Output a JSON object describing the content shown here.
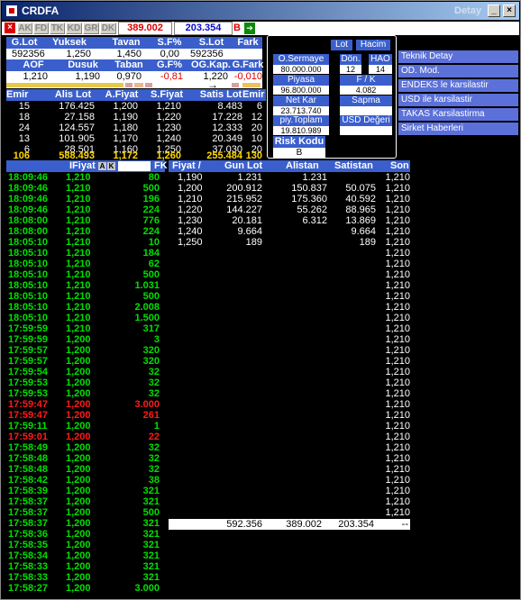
{
  "window": {
    "title": "CRDFA",
    "subtitle": "Detay"
  },
  "toolbar": {
    "buttons": [
      "AK",
      "FD",
      "TK",
      "KD",
      "GR",
      "DK"
    ],
    "sell_total": "389.002",
    "buy_total": "203.354",
    "b_label": "B"
  },
  "summary": {
    "headers1": [
      "G.Lot",
      "Yuksek",
      "Tavan",
      "S.F%",
      "S.Lot",
      "Fark"
    ],
    "values1": [
      "592356",
      "1,250",
      "1,450",
      "0,00",
      "592356",
      ""
    ],
    "headers2": [
      "AOF",
      "Dusuk",
      "Taban",
      "G.F%",
      "OG.Kap.",
      "G.Fark"
    ],
    "values2": [
      "1,210",
      "1,190",
      "0,970",
      "-0,81",
      "1,220",
      "-0,010"
    ]
  },
  "emir": {
    "headers": [
      "Emir",
      "Alis Lot",
      "A.Fiyat",
      "S.Fiyat",
      "Satis Lot",
      "Emir"
    ],
    "rows": [
      [
        "15",
        "176.425",
        "1,200",
        "1,210",
        "8.483",
        "6"
      ],
      [
        "18",
        "27.158",
        "1,190",
        "1,220",
        "17.228",
        "12"
      ],
      [
        "24",
        "124.557",
        "1,180",
        "1,230",
        "12.333",
        "20"
      ],
      [
        "13",
        "101.905",
        "1,170",
        "1,240",
        "20.349",
        "10"
      ],
      [
        "6",
        "28.501",
        "1,160",
        "1,250",
        "37.030",
        "20"
      ]
    ],
    "total": [
      "106",
      "588.493",
      "1,172",
      "1,260",
      "255.484",
      "130"
    ]
  },
  "panel": {
    "lot": "Lot",
    "hacim": "Hacim",
    "o_sermaye_label": "O.Sermaye",
    "o_sermaye_value": "80.000.000",
    "don_label": "Dön.",
    "don_value": "12",
    "hao_label": "HAO",
    "hao_value": "14",
    "piyasa_label": "Piyasa Değeri",
    "piyasa_value": "96.800.000",
    "fk_label": "F / K",
    "fk_value": "4.082",
    "netkar_label": "Net Kar",
    "netkar_value": "23.713.740",
    "sapma_label": "Sapma",
    "sapma_value": "",
    "piy_label": "piy.Toplam Lot",
    "piy_value": "19.810.989",
    "usd_label": "USD Değeri",
    "usd_value": "",
    "risk_label": "Risk Kodu",
    "risk_value": "B"
  },
  "links": [
    "Teknik Detay",
    "OD. Mod.",
    "ENDEKS le karsilastir",
    "USD ile karsilastir",
    "TAKAS Karsilastirma",
    "Sirket Haberleri"
  ],
  "trades_header": {
    "fiyat": "IFiyat",
    "a": "A",
    "k": "K",
    "fk": "FK"
  },
  "trades": [
    [
      "18:09:46",
      "1,210",
      "80",
      "up"
    ],
    [
      "18:09:46",
      "1,210",
      "500",
      "up"
    ],
    [
      "18:09:46",
      "1,210",
      "196",
      "up"
    ],
    [
      "18:09:46",
      "1,210",
      "224",
      "up"
    ],
    [
      "18:08:00",
      "1,210",
      "776",
      "up"
    ],
    [
      "18:08:00",
      "1,210",
      "224",
      "up"
    ],
    [
      "18:05:10",
      "1,210",
      "10",
      "up"
    ],
    [
      "18:05:10",
      "1,210",
      "184",
      "up"
    ],
    [
      "18:05:10",
      "1,210",
      "62",
      "up"
    ],
    [
      "18:05:10",
      "1,210",
      "500",
      "up"
    ],
    [
      "18:05:10",
      "1,210",
      "1.031",
      "up"
    ],
    [
      "18:05:10",
      "1,210",
      "500",
      "up"
    ],
    [
      "18:05:10",
      "1,210",
      "2.008",
      "up"
    ],
    [
      "18:05:10",
      "1,210",
      "1.500",
      "up"
    ],
    [
      "17:59:59",
      "1,210",
      "317",
      "up"
    ],
    [
      "17:59:59",
      "1,200",
      "3",
      "up"
    ],
    [
      "17:59:57",
      "1,200",
      "320",
      "up"
    ],
    [
      "17:59:57",
      "1,200",
      "320",
      "up"
    ],
    [
      "17:59:54",
      "1,200",
      "32",
      "up"
    ],
    [
      "17:59:53",
      "1,200",
      "32",
      "up"
    ],
    [
      "17:59:53",
      "1,200",
      "32",
      "up"
    ],
    [
      "17:59:47",
      "1,200",
      "3.000",
      "down"
    ],
    [
      "17:59:47",
      "1,200",
      "261",
      "down"
    ],
    [
      "17:59:11",
      "1,200",
      "1",
      "up"
    ],
    [
      "17:59:01",
      "1,200",
      "22",
      "down"
    ],
    [
      "17:58:49",
      "1,200",
      "32",
      "up"
    ],
    [
      "17:58:48",
      "1,200",
      "32",
      "up"
    ],
    [
      "17:58:48",
      "1,200",
      "32",
      "up"
    ],
    [
      "17:58:42",
      "1,200",
      "38",
      "up"
    ],
    [
      "17:58:39",
      "1,200",
      "321",
      "up"
    ],
    [
      "17:58:37",
      "1,200",
      "321",
      "up"
    ],
    [
      "17:58:37",
      "1,200",
      "500",
      "up"
    ],
    [
      "17:58:37",
      "1,200",
      "321",
      "up"
    ],
    [
      "17:58:36",
      "1,200",
      "321",
      "up"
    ],
    [
      "17:58:35",
      "1,200",
      "321",
      "up"
    ],
    [
      "17:58:34",
      "1,200",
      "321",
      "up"
    ],
    [
      "17:58:33",
      "1,200",
      "321",
      "up"
    ],
    [
      "17:58:33",
      "1,200",
      "321",
      "up"
    ],
    [
      "17:58:27",
      "1,200",
      "3.000",
      "up"
    ]
  ],
  "depth_header": [
    "Fiyat /",
    "Gun Lot",
    "Alistan",
    "Satistan",
    "Son"
  ],
  "depth": [
    [
      "1,190",
      "1.231",
      "1.231",
      ""
    ],
    [
      "1,200",
      "200.912",
      "150.837",
      "50.075"
    ],
    [
      "1,210",
      "215.952",
      "175.360",
      "40.592"
    ],
    [
      "1,220",
      "144.227",
      "55.262",
      "88.965"
    ],
    [
      "1,230",
      "20.181",
      "6.312",
      "13.869"
    ],
    [
      "1,240",
      "9.664",
      "",
      "9.664"
    ],
    [
      "1,250",
      "189",
      "",
      "189"
    ]
  ],
  "son_values": [
    "1,210",
    "1,210",
    "1,210",
    "1,210",
    "1,210",
    "1,210",
    "1,210",
    "1,210",
    "1,210",
    "1,210",
    "1,210",
    "1,210",
    "1,210",
    "1,210",
    "1,210",
    "1,210",
    "1,210",
    "1,210",
    "1,210",
    "1,210",
    "1,210",
    "1,210",
    "1,210",
    "1,210",
    "1,210",
    "1,210",
    "1,210",
    "1,210",
    "1,210",
    "1,210",
    "1,210",
    "1,210",
    "1,210"
  ],
  "totals": [
    "592.356",
    "389.002",
    "203.354",
    "--"
  ],
  "colors": {
    "header_blue": "#3a5fcd",
    "up": "#00e000",
    "down": "#ff1a1a",
    "link_bg": "#5b70d8"
  }
}
